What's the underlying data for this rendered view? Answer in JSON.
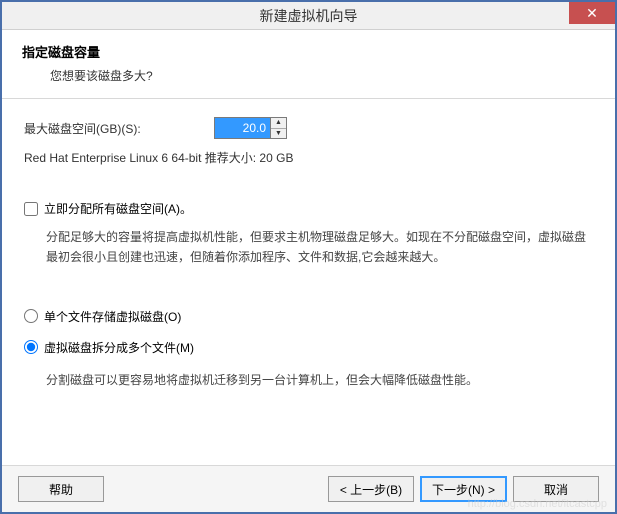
{
  "window": {
    "title": "新建虚拟机向导",
    "close_icon": "✕"
  },
  "header": {
    "title": "指定磁盘容量",
    "subtitle": "您想要该磁盘多大?"
  },
  "disk_size": {
    "label": "最大磁盘空间(GB)(S):",
    "value": "20.0"
  },
  "recommend_text": "Red Hat Enterprise Linux 6 64-bit 推荐大小: 20 GB",
  "allocate": {
    "checkbox_label": "立即分配所有磁盘空间(A)。",
    "description": "分配足够大的容量将提高虚拟机性能，但要求主机物理磁盘足够大。如现在不分配磁盘空间，虚拟磁盘最初会很小且创建也迅速，但随着你添加程序、文件和数据,它会越来越大。"
  },
  "file_option": {
    "single_label": "单个文件存储虚拟磁盘(O)",
    "split_label": "虚拟磁盘拆分成多个文件(M)",
    "split_description": "分割磁盘可以更容易地将虚拟机迁移到另一台计算机上，但会大幅降低磁盘性能。"
  },
  "footer": {
    "help": "帮助",
    "back": "< 上一步(B)",
    "next": "下一步(N) >",
    "cancel": "取消"
  },
  "watermark": "http://blog.csdn.net/itcastcpp"
}
